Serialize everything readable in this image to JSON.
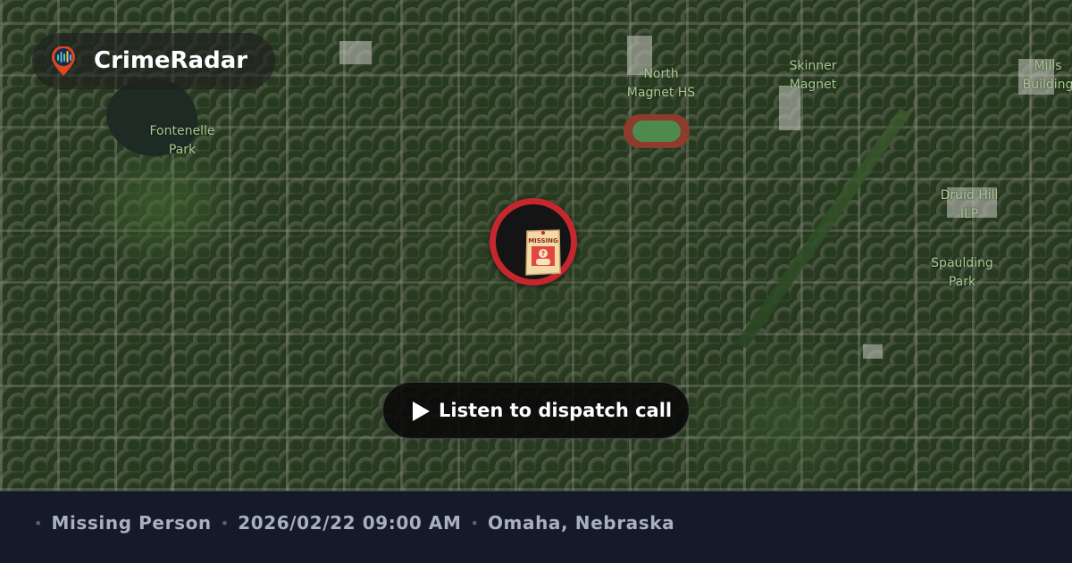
{
  "brand": {
    "name": "CrimeRadar",
    "logo_icon": "radar-pin-icon"
  },
  "map": {
    "labels": {
      "fontenelle_park": "Fontenelle\nPark",
      "north_magnet_hs": "North\nMagnet HS",
      "skinner_magnet": "Skinner\nMagnet",
      "mills_building": "Mills\nBuilding",
      "druid_hill_ilp": "Druid Hill\nILP",
      "spaulding_park": "Spaulding\nPark"
    },
    "marker": {
      "icon": "missing-poster-icon",
      "poster_text": "MISSING",
      "ring_color": "#c6262e"
    }
  },
  "listen_button": {
    "label": "Listen to dispatch call",
    "icon": "play-icon"
  },
  "footer": {
    "incident_type": "Missing Person",
    "datetime": "2026/02/22 09:00 AM",
    "location": "Omaha, Nebraska",
    "separator": "•"
  }
}
